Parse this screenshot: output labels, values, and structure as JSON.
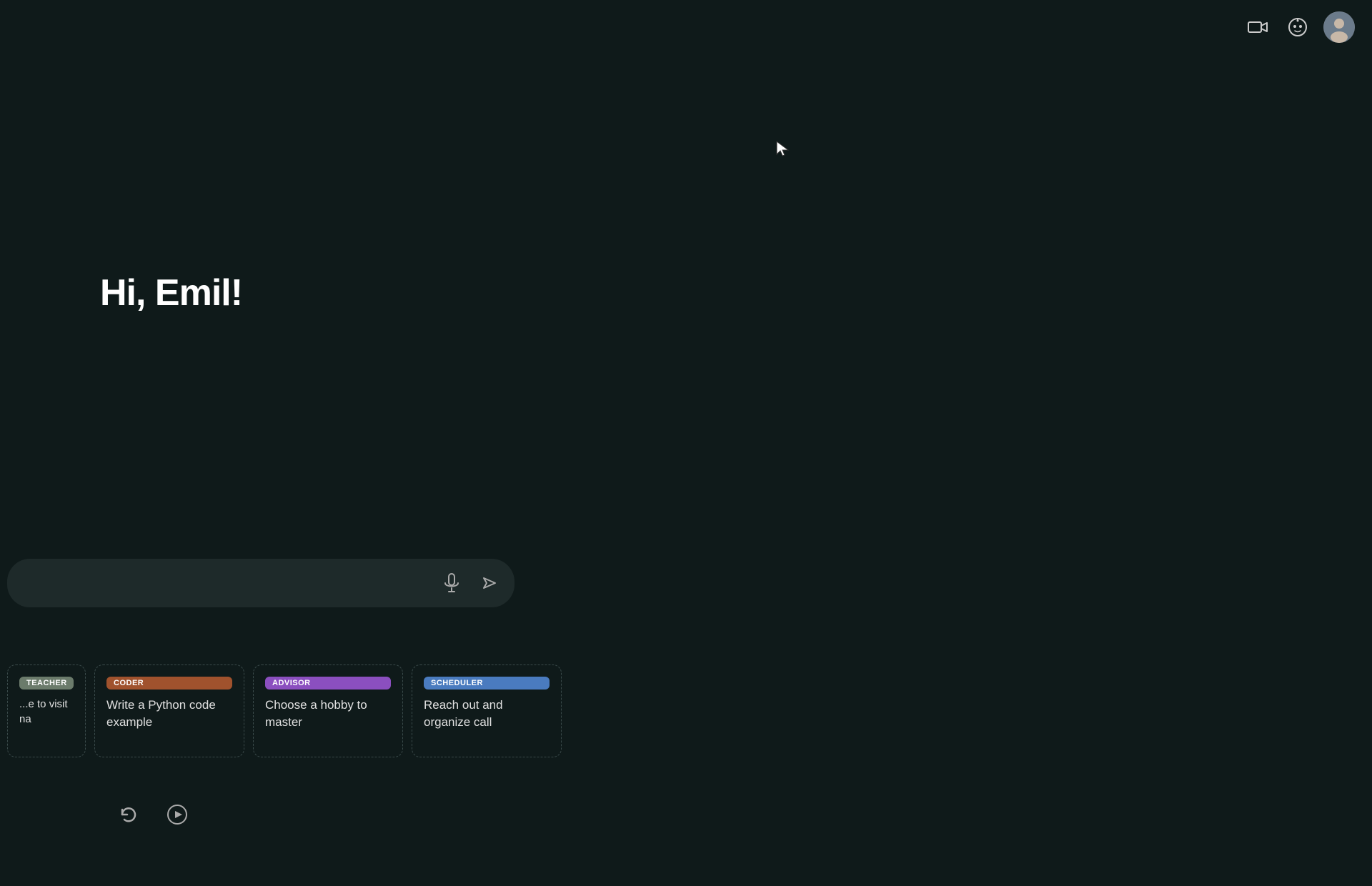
{
  "header": {
    "video_icon": "video-camera",
    "robot_icon": "robot-face",
    "avatar_alt": "User avatar"
  },
  "greeting": {
    "text": "Hi, Emil!"
  },
  "search": {
    "placeholder": "",
    "mic_label": "Microphone",
    "send_label": "Send"
  },
  "cards": [
    {
      "badge": "TEACHER",
      "badge_type": "teacher",
      "text": "...e to visit\nna",
      "partial": true
    },
    {
      "badge": "CODER",
      "badge_type": "coder",
      "text": "Write a Python code example",
      "partial": false
    },
    {
      "badge": "ADVISOR",
      "badge_type": "advisor",
      "text": "Choose a hobby to master",
      "partial": false
    },
    {
      "badge": "SCHEDULER",
      "badge_type": "scheduler",
      "text": "Reach out and organize call",
      "partial": false
    }
  ],
  "bottom_controls": {
    "reset_label": "Reset",
    "play_label": "Play"
  }
}
